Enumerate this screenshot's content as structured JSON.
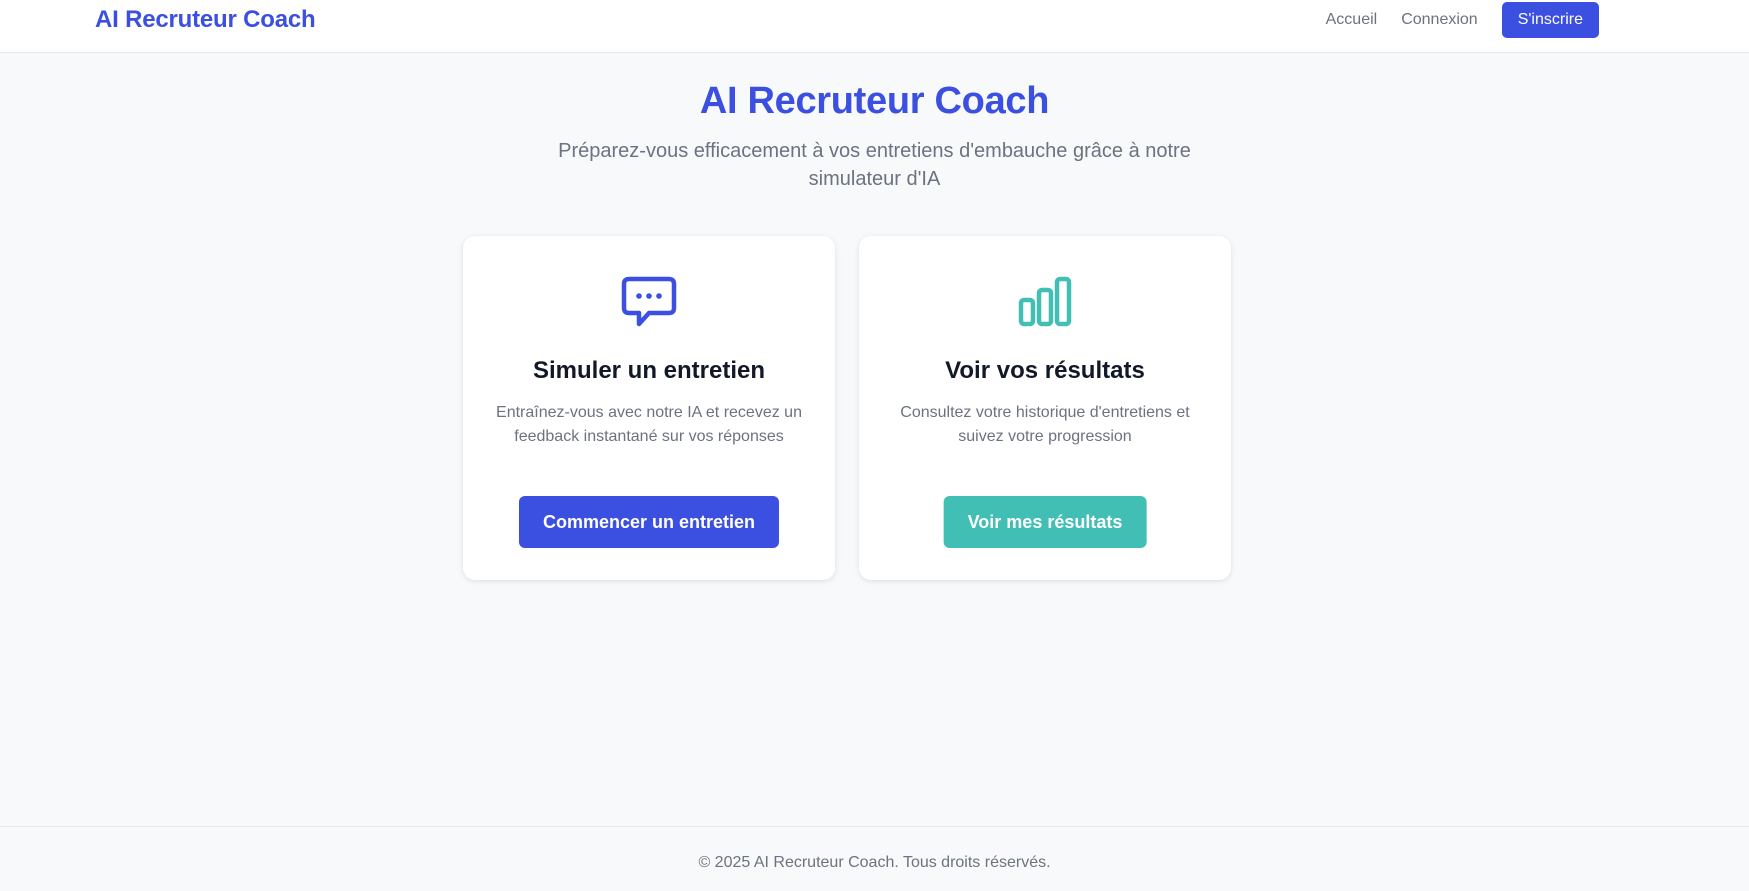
{
  "colors": {
    "primary": "#3b4fe0",
    "teal": "#42bfb5",
    "background": "#f8f9fb",
    "muted_text": "#6b7280"
  },
  "header": {
    "brand": "AI Recruteur Coach",
    "nav": {
      "home": "Accueil",
      "login": "Connexion",
      "signup": "S'inscrire"
    }
  },
  "hero": {
    "title": "AI Recruteur Coach",
    "subtitle": "Préparez-vous efficacement à vos entretiens d'embauche grâce à notre simulateur d'IA"
  },
  "cards": [
    {
      "icon": "chat-bubble-icon",
      "title": "Simuler un entretien",
      "description": "Entraînez-vous avec notre IA et recevez un feedback instantané sur vos réponses",
      "button": "Commencer un entretien"
    },
    {
      "icon": "bar-chart-icon",
      "title": "Voir vos résultats",
      "description": "Consultez votre historique d'entretiens et suivez votre progression",
      "button": "Voir mes résultats"
    }
  ],
  "footer": {
    "text": "© 2025 AI Recruteur Coach. Tous droits réservés."
  }
}
